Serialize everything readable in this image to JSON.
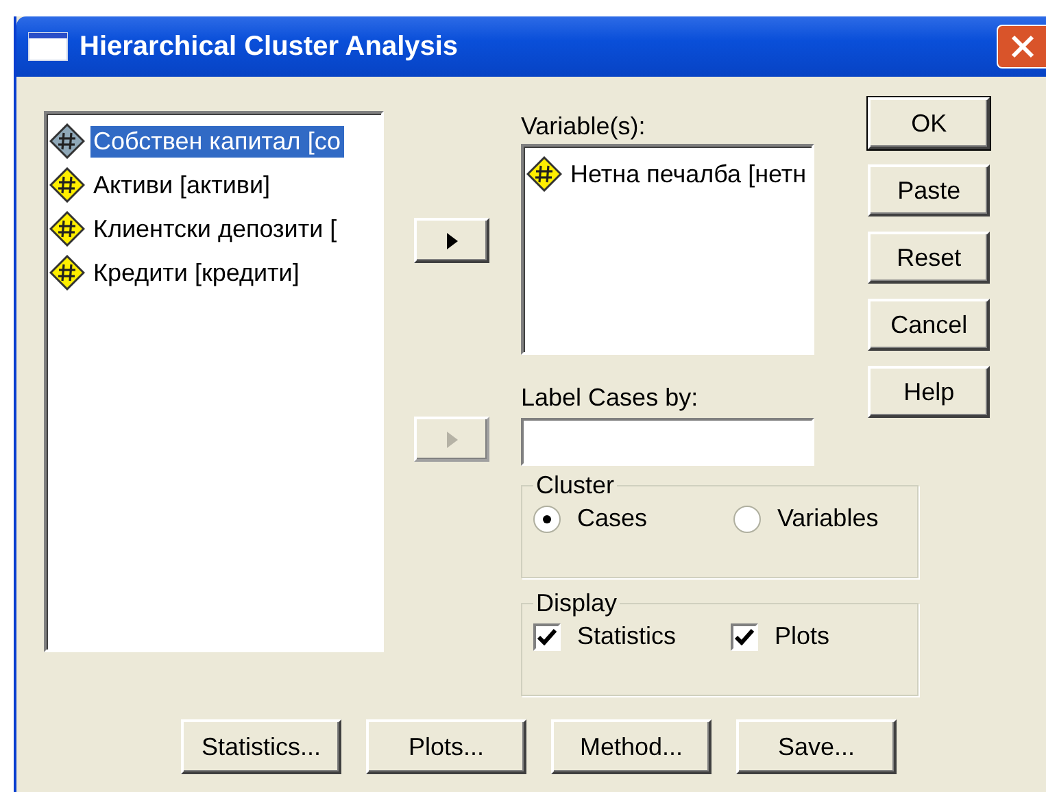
{
  "window": {
    "title": "Hierarchical Cluster Analysis"
  },
  "source_list": {
    "items": [
      {
        "label": "Собствен капитал [со",
        "selected": true
      },
      {
        "label": "Активи [активи]",
        "selected": false
      },
      {
        "label": "Клиентски депозити [",
        "selected": false
      },
      {
        "label": "Кредити [кредити]",
        "selected": false
      }
    ]
  },
  "move_buttons": [
    {
      "disabled": false
    },
    {
      "disabled": true
    }
  ],
  "variables": {
    "label": "Variable(s):",
    "items": [
      {
        "label": "Нетна печалба [нетн"
      }
    ]
  },
  "label_cases": {
    "label": "Label Cases by:"
  },
  "cluster": {
    "title": "Cluster",
    "options": [
      {
        "label": "Cases",
        "selected": true
      },
      {
        "label": "Variables",
        "selected": false
      }
    ]
  },
  "display": {
    "title": "Display",
    "options": [
      {
        "label": "Statistics",
        "checked": true
      },
      {
        "label": "Plots",
        "checked": true
      }
    ]
  },
  "side_buttons": [
    {
      "label": "OK",
      "default": true
    },
    {
      "label": "Paste",
      "default": false
    },
    {
      "label": "Reset",
      "default": false
    },
    {
      "label": "Cancel",
      "default": false
    },
    {
      "label": "Help",
      "default": false
    }
  ],
  "bottom_buttons": [
    "Statistics...",
    "Plots...",
    "Method...",
    "Save..."
  ]
}
